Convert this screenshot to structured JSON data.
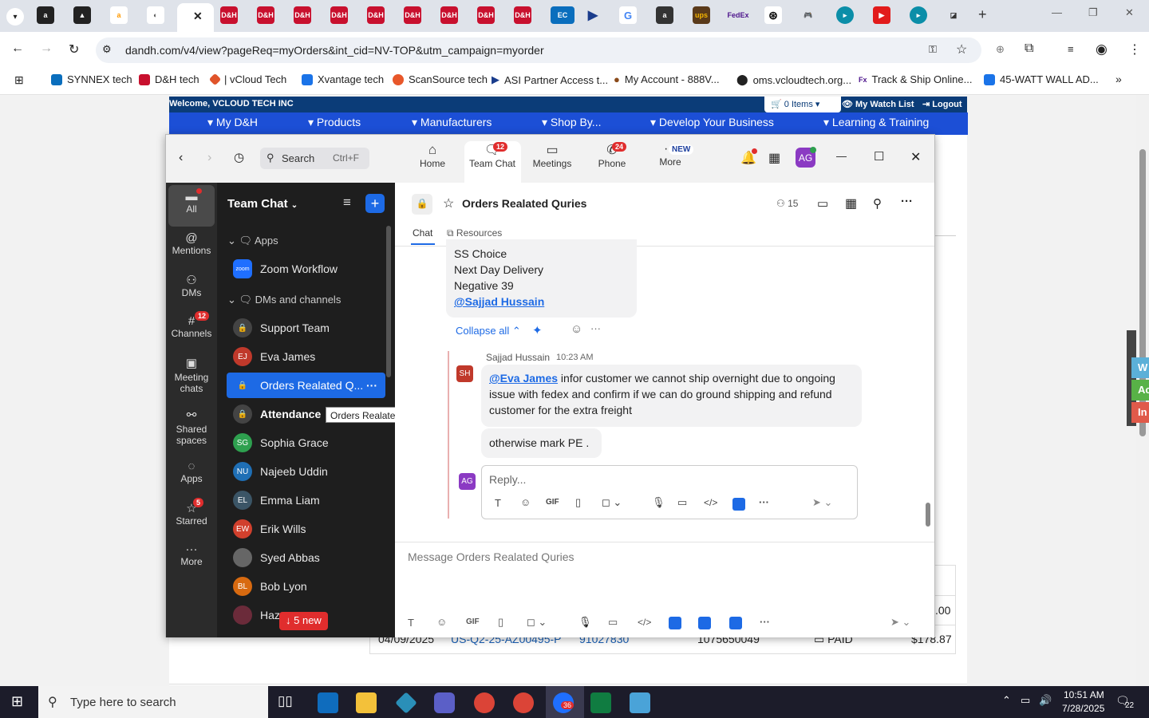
{
  "browser": {
    "tabs": [
      "A",
      "Notion",
      "amazon",
      "site",
      "D&H active",
      "D&H",
      "D&H",
      "D&H",
      "D&H",
      "D&H",
      "D&H",
      "D&H",
      "D&H",
      "EC",
      "ASI",
      "Google",
      "A",
      "UPS",
      "FedEx",
      "OpenAI",
      "game",
      "Zoom",
      "YouTube",
      "Zoom",
      "C"
    ],
    "url": "dandh.com/v4/view?pageReq=myOrders&int_cid=NV-TOP&utm_campaign=myorder",
    "bookmarks": [
      "SYNNEX tech",
      "D&H tech",
      "| vCloud Tech",
      "Xvantage tech",
      "ScanSource tech",
      "ASI Partner Access t...",
      "My Account - 888V...",
      "oms.vcloudtech.org...",
      "Track & Ship Online...",
      "45-WATT WALL AD..."
    ]
  },
  "site": {
    "welcome": "Welcome, VCLOUD TECH INC",
    "cart": "0 Items",
    "watchlist": "My Watch List",
    "logout": "Logout",
    "nav": [
      "My D&H",
      "Products",
      "Manufacturers",
      "Shop By...",
      "Develop Your Business",
      "Learning & Training"
    ],
    "row_date": "04/09/2025",
    "row_quote": "US-Q2-25-AZ00495-P",
    "row_order": "91027830",
    "row_po": "1075650049",
    "row_status": "PAID",
    "row_amount": "$178.87",
    "row_prev_amount": ".00",
    "side_tabs": [
      "W",
      "Ac",
      "In"
    ]
  },
  "zoom": {
    "search": "Search",
    "search_shortcut": "Ctrl+F",
    "tabs": [
      {
        "label": "Home"
      },
      {
        "label": "Team Chat",
        "badge": "12"
      },
      {
        "label": "Meetings"
      },
      {
        "label": "Phone",
        "badge": "24"
      },
      {
        "label": "More",
        "badge": "NEW"
      }
    ],
    "avatar": "AG",
    "rail": [
      {
        "label": "All"
      },
      {
        "label": "Mentions"
      },
      {
        "label": "DMs"
      },
      {
        "label": "Channels",
        "badge": "12"
      },
      {
        "label": "Meeting chats"
      },
      {
        "label": "Shared spaces"
      },
      {
        "label": "Apps"
      },
      {
        "label": "Starred",
        "badge": "5"
      },
      {
        "label": "More"
      }
    ],
    "list_title": "Team Chat",
    "sections": {
      "apps": "Apps",
      "dms": "DMs and channels"
    },
    "items": [
      {
        "name": "Zoom Workflow",
        "initials": "zoom",
        "color": "#1f6fff"
      },
      {
        "name": "Support Team",
        "initials": "",
        "color": "#444"
      },
      {
        "name": "Eva James",
        "initials": "EJ",
        "color": "#c0392b"
      },
      {
        "name": "Orders Realated Q...",
        "initials": "",
        "color": "#1d6ae5"
      },
      {
        "name": "Attendance",
        "initials": "",
        "color": "#444"
      },
      {
        "name": "Sophia Grace",
        "initials": "SG",
        "color": "#2ea04f"
      },
      {
        "name": "Najeeb Uddin",
        "initials": "NU",
        "color": "#1f6fb5"
      },
      {
        "name": "Emma Liam",
        "initials": "EL",
        "color": "#3b5566"
      },
      {
        "name": "Erik Wills",
        "initials": "EW",
        "color": "#d1402d"
      },
      {
        "name": "Syed Abbas",
        "initials": "",
        "color": "#555"
      },
      {
        "name": "Bob Lyon",
        "initials": "BL",
        "color": "#d86a10"
      },
      {
        "name": "Haz...",
        "initials": "",
        "color": "#6b2b3a"
      }
    ],
    "tooltip": "Orders Realated Quries",
    "new_pill": "5 new",
    "channel": {
      "title": "Orders Realated Quries",
      "members": "15",
      "tab_chat": "Chat",
      "tab_resources": "Resources"
    },
    "thread": {
      "prev_lines": [
        "SS Choice",
        "Next Day Delivery",
        "Negative 39"
      ],
      "prev_mention": "@Sajjad Hussain",
      "collapse": "Collapse all",
      "sender": "Sajjad Hussain",
      "time": "10:23 AM",
      "sender_initials": "SH",
      "mention": "@Eva James",
      "msg1_rest": " infor customer we cannot ship overnight due to ongoing issue with fedex and confirm if we can do ground shipping and refund customer for the extra freight",
      "msg2": "otherwise mark PE .",
      "reply_placeholder": "Reply...",
      "my_initials": "AG"
    },
    "composer_placeholder": "Message Orders Realated Quries"
  },
  "taskbar": {
    "search_placeholder": "Type here to search",
    "zoom_badge": "36",
    "time": "10:51 AM",
    "date": "7/28/2025",
    "notif_count": "22"
  }
}
